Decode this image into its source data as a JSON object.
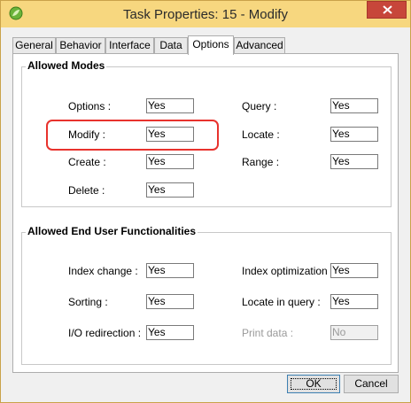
{
  "window": {
    "title": "Task Properties: 15 -    Modify",
    "close_icon": "close-icon",
    "app_icon": "leaf-app-icon"
  },
  "tabs": [
    {
      "label": "General"
    },
    {
      "label": "Behavior"
    },
    {
      "label": "Interface"
    },
    {
      "label": "Data"
    },
    {
      "label": "Options",
      "active": true
    },
    {
      "label": "Advanced"
    }
  ],
  "allowed_modes": {
    "title": "Allowed Modes",
    "options_label": "Options :",
    "options_value": "Yes",
    "query_label": "Query :",
    "query_value": "Yes",
    "modify_label": "Modify :",
    "modify_value": "Yes",
    "locate_label": "Locate :",
    "locate_value": "Yes",
    "create_label": "Create :",
    "create_value": "Yes",
    "range_label": "Range :",
    "range_value": "Yes",
    "delete_label": "Delete :",
    "delete_value": "Yes"
  },
  "end_user": {
    "title": "Allowed End User Functionalities",
    "index_change_label": "Index change :",
    "index_change_value": "Yes",
    "index_optimization_label": "Index optimization :",
    "index_optimization_value": "Yes",
    "sorting_label": "Sorting :",
    "sorting_value": "Yes",
    "locate_in_query_label": "Locate in query :",
    "locate_in_query_value": "Yes",
    "io_redirection_label": "I/O redirection :",
    "io_redirection_value": "Yes",
    "print_data_label": "Print data :",
    "print_data_value": "No"
  },
  "buttons": {
    "ok": "OK",
    "cancel": "Cancel"
  },
  "colors": {
    "titlebar": "#f7d77f",
    "close": "#c7463a",
    "highlight": "#e8322d"
  }
}
